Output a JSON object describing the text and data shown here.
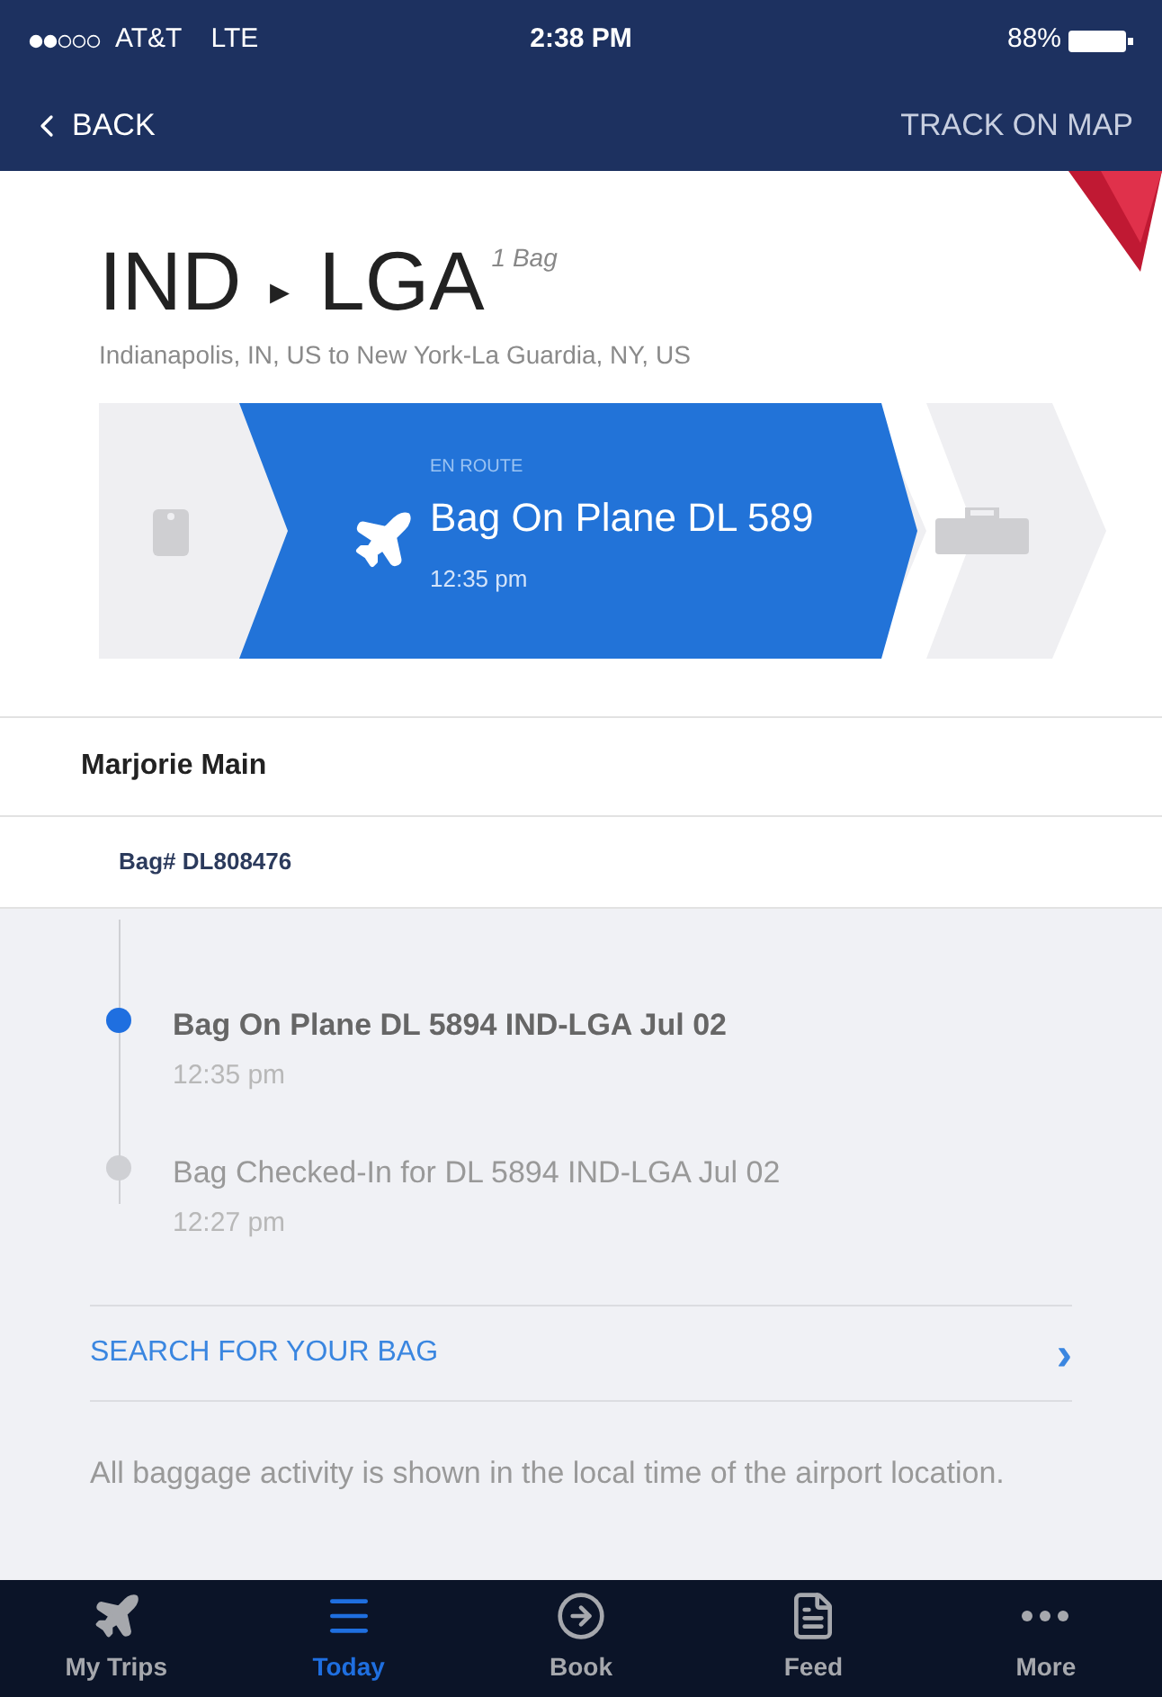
{
  "status_bar": {
    "carrier": "AT&T",
    "network": "LTE",
    "time": "2:38 PM",
    "battery": "88%"
  },
  "nav": {
    "back": "BACK",
    "action": "TRACK ON MAP"
  },
  "route": {
    "from": "IND",
    "arrow": "▸",
    "to": "LGA",
    "bags": "1 Bag",
    "description": "Indianapolis, IN, US to New York-La Guardia, NY, US"
  },
  "progress": {
    "status": "EN ROUTE",
    "title": "Bag On Plane DL 589",
    "time": "12:35 pm"
  },
  "passenger": "Marjorie Main",
  "bag_number": "Bag# DL808476",
  "events": [
    {
      "title": "Bag On Plane DL 5894 IND-LGA Jul 02",
      "time": "12:35 pm",
      "current": true
    },
    {
      "title": "Bag Checked-In for DL 5894 IND-LGA Jul 02",
      "time": "12:27 pm",
      "current": false
    }
  ],
  "search_link": {
    "label": "SEARCH FOR YOUR BAG",
    "chevron": "›"
  },
  "note": "All baggage activity is shown in the local time of the airport location.",
  "tabs": [
    {
      "label": "My Trips",
      "kind": "plane",
      "selected": false
    },
    {
      "label": "Today",
      "kind": "list",
      "selected": true
    },
    {
      "label": "Book",
      "kind": "book",
      "selected": false
    },
    {
      "label": "Feed",
      "kind": "feed",
      "selected": false
    },
    {
      "label": "More",
      "kind": "more",
      "selected": false
    }
  ]
}
